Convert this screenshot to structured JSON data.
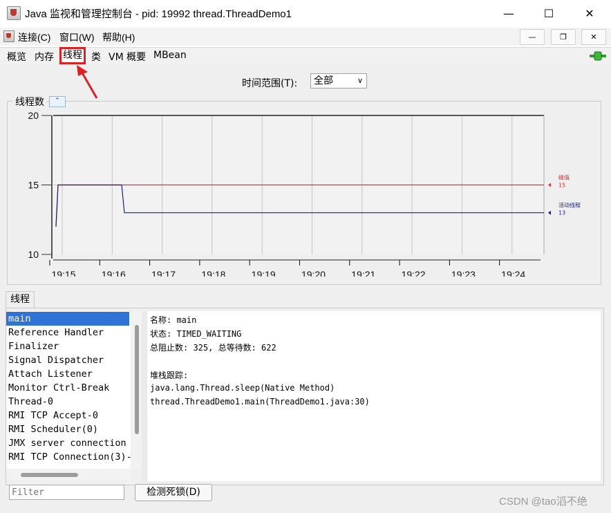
{
  "window": {
    "title": "Java 监视和管理控制台 - pid: 19992 thread.ThreadDemo1",
    "minimize": "—",
    "maximize": "☐",
    "close": "✕"
  },
  "menu": {
    "items": [
      "连接(C)",
      "窗口(W)",
      "帮助(H)"
    ],
    "inner_minimize": "—",
    "inner_restore": "❐",
    "inner_close": "✕"
  },
  "tabs": [
    "概览",
    "内存",
    "线程",
    "类",
    "VM 概要",
    "MBean"
  ],
  "selected_tab": "线程",
  "time_range": {
    "label": "时间范围(T):",
    "value": "全部"
  },
  "chart_panel": {
    "title": "线程数"
  },
  "chart_data": {
    "type": "line",
    "x": [
      "19:15",
      "19:16",
      "19:17",
      "19:18",
      "19:19",
      "19:20",
      "19:21",
      "19:22",
      "19:23",
      "19:24"
    ],
    "yticks": [
      "20",
      "15",
      "10"
    ],
    "ylim": [
      10,
      20
    ],
    "series": [
      {
        "name": "峰值",
        "color": "#e03030",
        "current": "15"
      },
      {
        "name": "活动线程",
        "color": "#1a1a9a",
        "current": "13"
      }
    ]
  },
  "threads_tab": "线程",
  "threads": [
    "main",
    "Reference Handler",
    "Finalizer",
    "Signal Dispatcher",
    "Attach Listener",
    "Monitor Ctrl-Break",
    "Thread-0",
    "RMI TCP Accept-0",
    "RMI Scheduler(0)",
    "JMX server connection",
    "RMI TCP Connection(3)-"
  ],
  "selected_thread": "main",
  "detail": {
    "name_line": "名称: main",
    "state_line": "状态: TIMED_WAITING",
    "counts_line": "总阻止数: 325, 总等待数: 622",
    "stack_label": "堆栈跟踪:",
    "stack": [
      "java.lang.Thread.sleep(Native Method)",
      "thread.ThreadDemo1.main(ThreadDemo1.java:30)"
    ]
  },
  "filter_placeholder": "Filter",
  "deadlock_button": "检测死锁(D)",
  "watermark": "CSDN @tao滔不绝"
}
